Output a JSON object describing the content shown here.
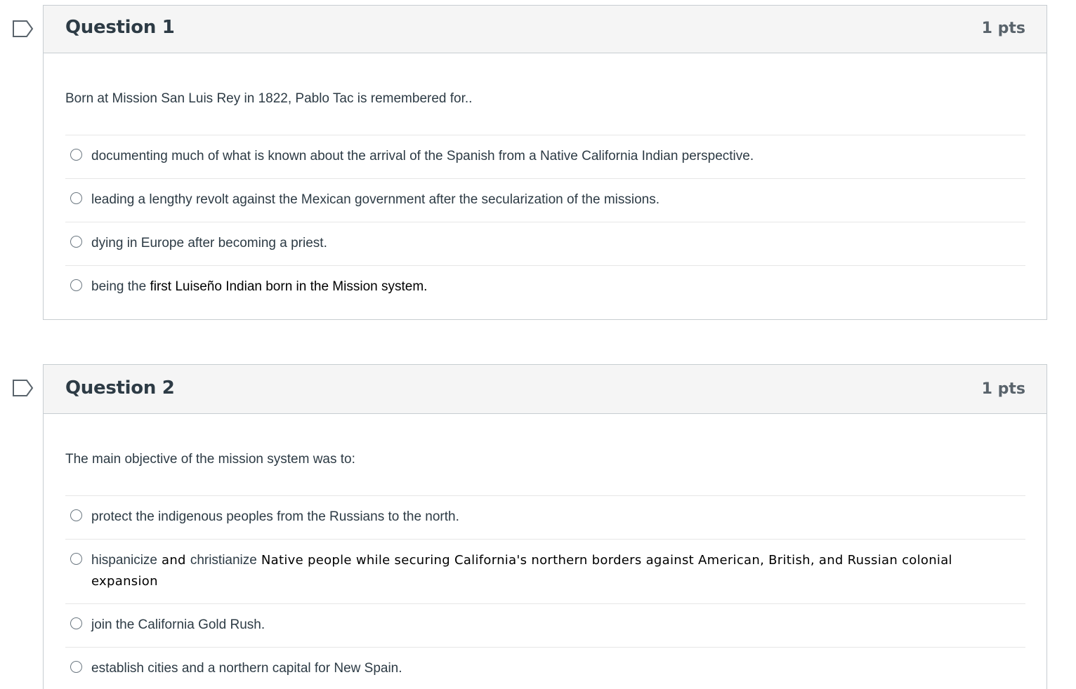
{
  "questions": [
    {
      "title": "Question 1",
      "points": "1 pts",
      "prompt": "Born at Mission San Luis Rey in 1822, Pablo Tac is remembered for..",
      "answers": [
        {
          "text": "documenting much of what is known about the arrival of the Spanish from a Native California Indian perspective."
        },
        {
          "text": "leading a lengthy revolt against the Mexican government after the secularization of the missions."
        },
        {
          "text": "dying in Europe after becoming a priest."
        },
        {
          "part1": "being the ",
          "part2": "first Luiseño Indian born in the Mission system."
        }
      ]
    },
    {
      "title": "Question 2",
      "points": "1 pts",
      "prompt": "The main objective of the mission system was to:",
      "answers": [
        {
          "text": "protect the indigenous peoples from the Russians to the north."
        },
        {
          "part1": "hispanicize",
          "part2": " and ",
          "part3": "christianize",
          "part4": " Native people while securing California's northern borders against American, British, and Russian colonial expansion"
        },
        {
          "text": "join the California Gold Rush."
        },
        {
          "text": "establish cities and a northern capital for New Spain."
        }
      ]
    }
  ],
  "icons": {
    "flag": "flag-question-icon",
    "radio": "radio-button"
  },
  "colors": {
    "header_bg": "#f5f5f5",
    "border": "#c7cdd1",
    "text": "#2d3b45",
    "divider": "#e6e6e6"
  }
}
